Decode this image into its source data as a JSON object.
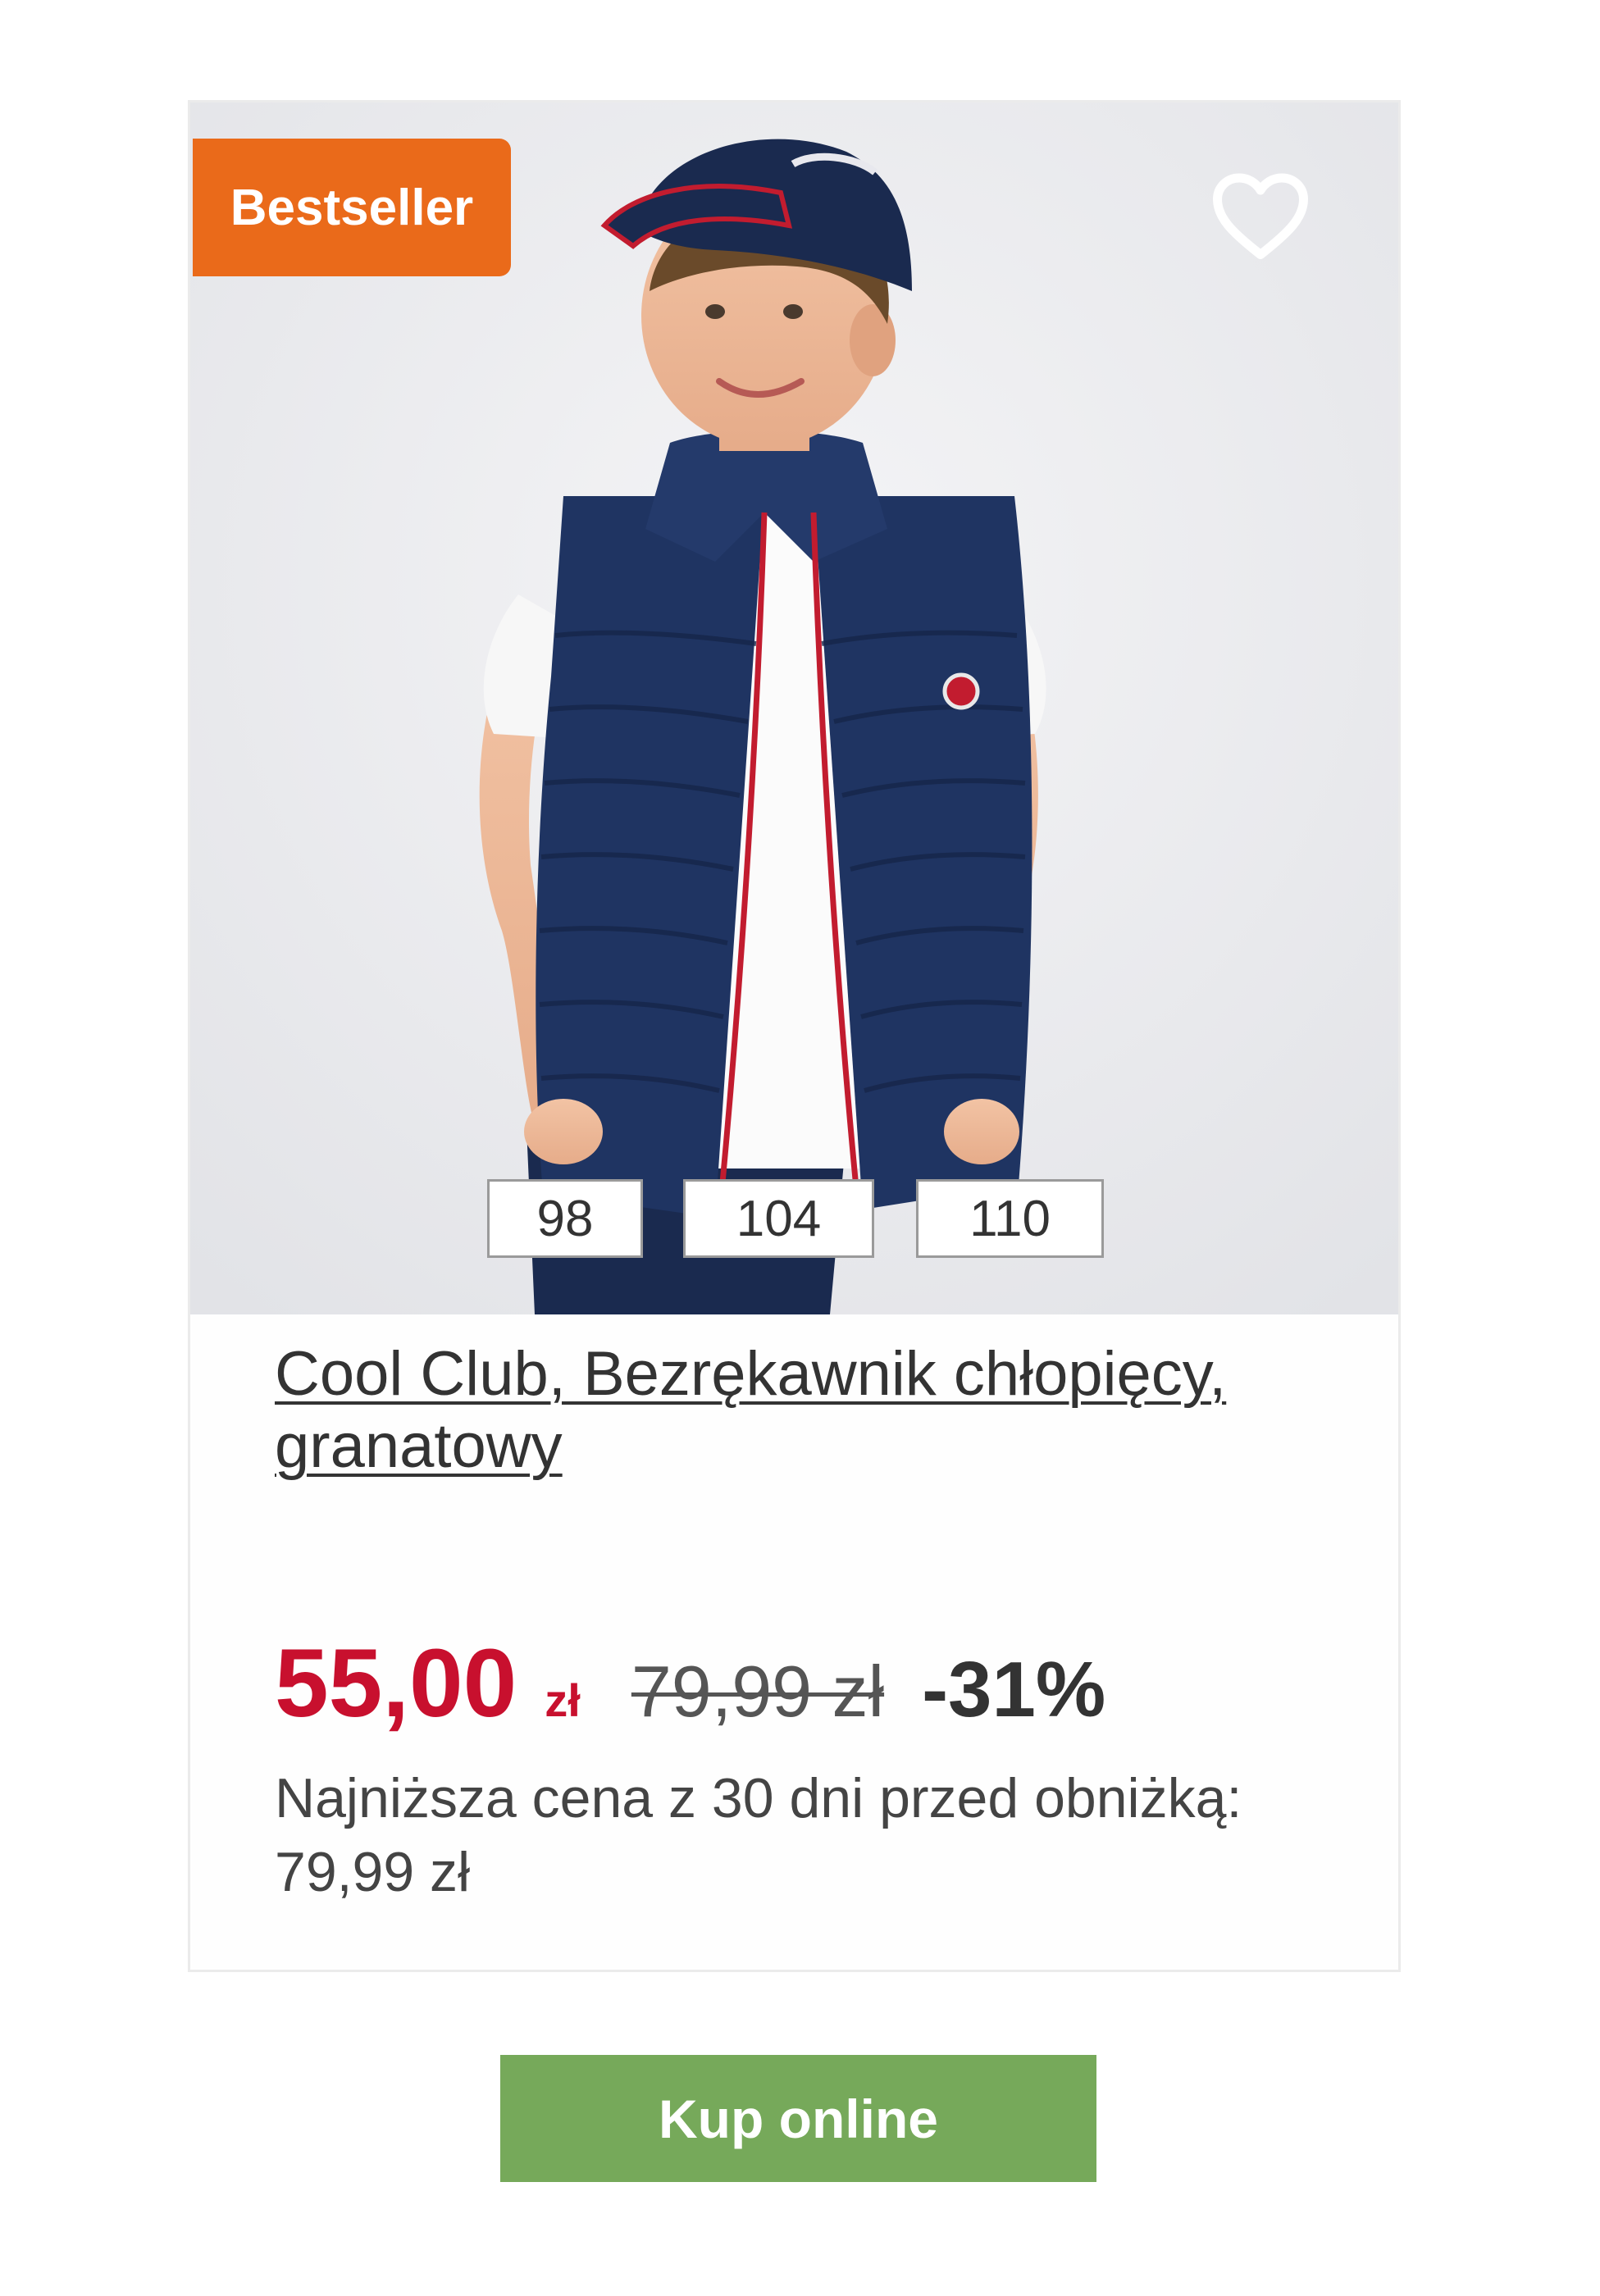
{
  "colors": {
    "badge": "#ea6a1a",
    "price": "#c8102e",
    "button": "#76a95a"
  },
  "product": {
    "badge": "Bestseller",
    "favorite_icon": "heart-outline-icon",
    "sizes": [
      "98",
      "104",
      "110"
    ],
    "title": "Cool Club, Bezrękawnik chłopięcy, granatowy",
    "price": "55,00",
    "currency": "zł",
    "old_price": "79,99 zł",
    "discount": "-31%",
    "lowest_price_label": "Najniższa cena z 30 dni przed obniżką:",
    "lowest_price": "79,99 zł"
  },
  "actions": {
    "buy_label": "Kup online"
  }
}
